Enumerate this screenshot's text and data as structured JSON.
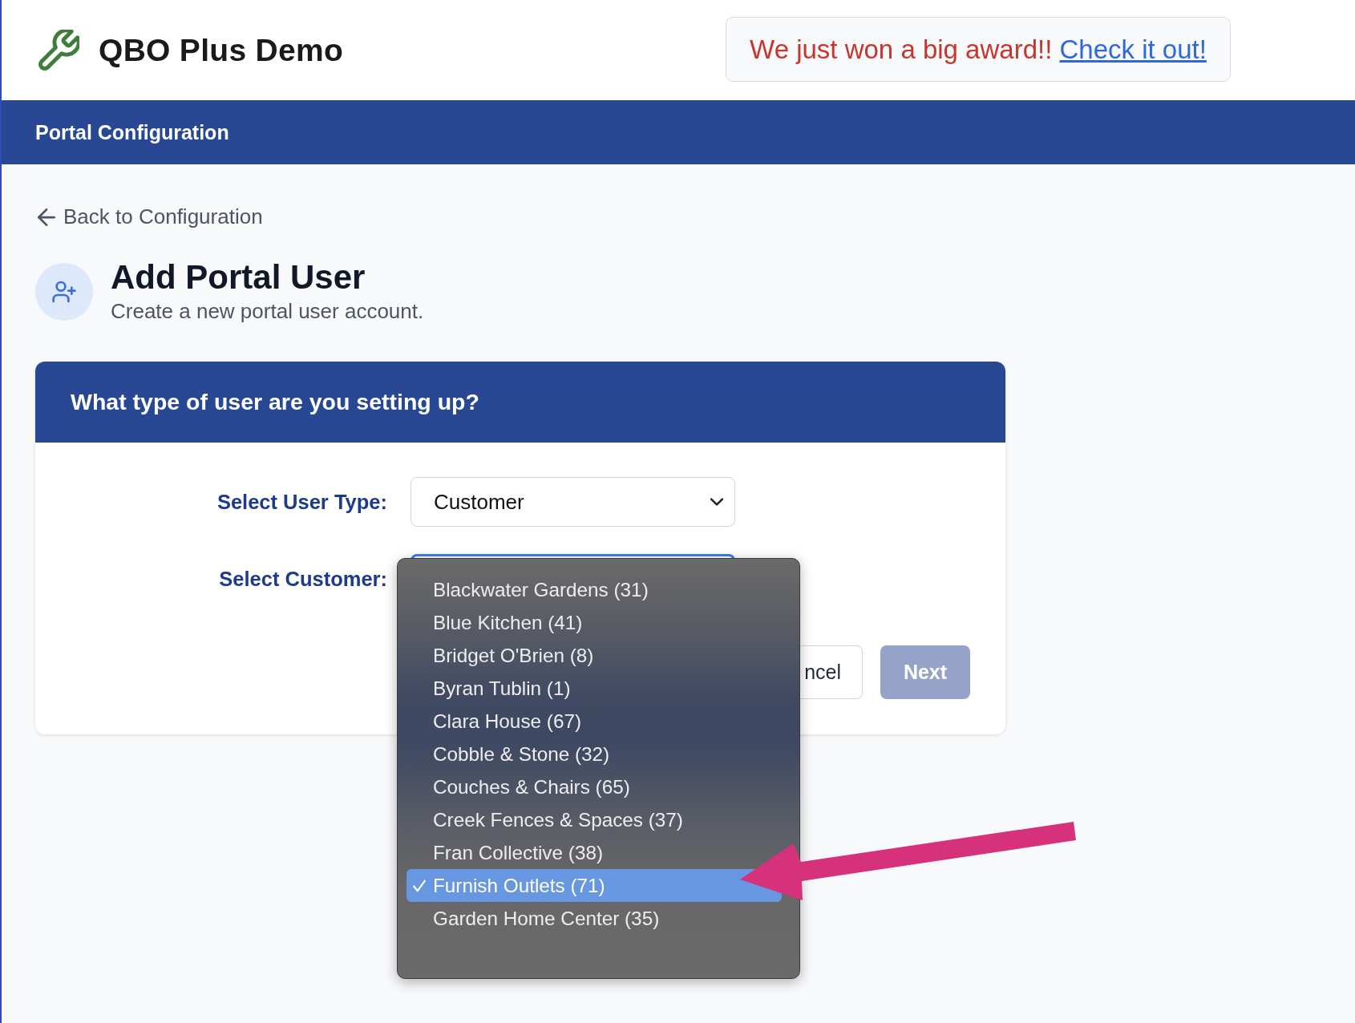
{
  "header": {
    "app_title": "QBO Plus Demo",
    "announcement": {
      "text": "We just won a big award!!",
      "link": "Check it out!"
    }
  },
  "nav_bar": {
    "title": "Portal Configuration"
  },
  "back_link": "Back to Configuration",
  "page_header": {
    "title": "Add Portal User",
    "subtitle": "Create a new portal user account."
  },
  "card": {
    "title": "What type of user are you setting up?",
    "fields": [
      {
        "label": "Select User Type:",
        "value": "Customer",
        "focused": false
      },
      {
        "label": "Select Customer:",
        "focused": true
      }
    ],
    "buttons": [
      {
        "label": "ncel",
        "kind": "secondary",
        "disabled": false
      },
      {
        "label": "Next",
        "kind": "primary",
        "disabled": true
      }
    ]
  },
  "dropdown_menu": {
    "options": [
      {
        "label": "Blackwater Gardens (31)",
        "selected": false
      },
      {
        "label": "Blue Kitchen (41)",
        "selected": false
      },
      {
        "label": "Bridget O'Brien (8)",
        "selected": false
      },
      {
        "label": "Byran Tublin (1)",
        "selected": false
      },
      {
        "label": "Clara House (67)",
        "selected": false
      },
      {
        "label": "Cobble & Stone (32)",
        "selected": false
      },
      {
        "label": "Couches & Chairs (65)",
        "selected": false
      },
      {
        "label": "Creek Fences & Spaces (37)",
        "selected": false
      },
      {
        "label": "Fran Collective (38)",
        "selected": false
      },
      {
        "label": "Furnish Outlets (71)",
        "selected": true
      },
      {
        "label": "Garden Home Center (35)",
        "selected": false
      }
    ]
  }
}
